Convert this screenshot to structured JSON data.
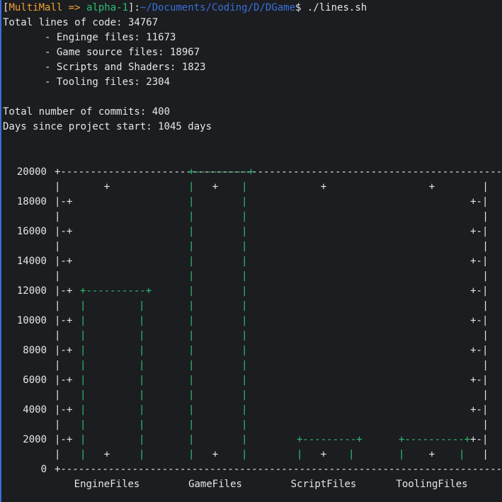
{
  "prompt": {
    "open_bracket": "[",
    "user": "MultiMall",
    "arrow": " => ",
    "branch": "alpha-1",
    "close_bracket": "]:",
    "path": "~/Documents/Coding/D/DGame",
    "dollar": "$ ",
    "command": "./lines.sh"
  },
  "output": {
    "total_lines": "Total lines of code: 34767",
    "engine_files": "       - Enginge files: 11673",
    "game_files": "       - Game source files: 18967",
    "scripts_shaders": "       - Scripts and Shaders: 1823",
    "tooling_files": "       - Tooling files: 2304",
    "total_commits": "Total number of commits: 400",
    "days_since": "Days since project start: 1045 days"
  },
  "colors": {
    "background": "#1b1d21",
    "text": "#e6e6e6",
    "user": "#f0a030",
    "branch": "#2fbf71",
    "path": "#3b6fd8",
    "bars": "#2fbf71"
  },
  "chart_data": {
    "type": "bar",
    "style": "ascii-gnuplot",
    "categories": [
      "EngineFiles",
      "GameFiles",
      "ScriptFiles",
      "ToolingFiles"
    ],
    "values": [
      12000,
      20000,
      2000,
      2000
    ],
    "ylim": [
      0,
      20000
    ],
    "yticks": [
      "20000",
      "18000",
      "16000",
      "14000",
      "12000",
      "10000",
      "8000",
      "6000",
      "4000",
      "2000",
      "0"
    ],
    "ytick_values": [
      20000,
      18000,
      16000,
      14000,
      12000,
      10000,
      8000,
      6000,
      4000,
      2000,
      0
    ]
  }
}
